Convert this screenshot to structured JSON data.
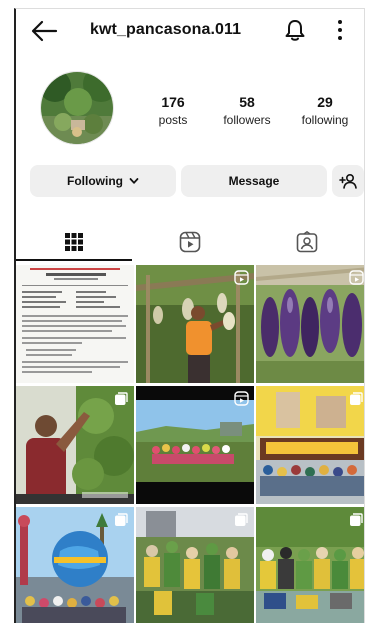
{
  "header": {
    "username": "kwt_pancasona.011",
    "back_icon": "arrow-left-icon",
    "notification_icon": "bell-icon",
    "more_icon": "more-vertical-icon"
  },
  "profile": {
    "stats": [
      {
        "value": "176",
        "label": "posts"
      },
      {
        "value": "58",
        "label": "followers"
      },
      {
        "value": "29",
        "label": "following"
      }
    ]
  },
  "actions": {
    "following_label": "Following",
    "message_label": "Message",
    "add_user_icon": "person-add-icon"
  },
  "tabs": [
    {
      "icon": "grid-icon",
      "active": true
    },
    {
      "icon": "reels-icon",
      "active": false
    },
    {
      "icon": "tagged-icon",
      "active": false
    }
  ],
  "posts": [
    {
      "caption": "",
      "type": "photo"
    },
    {
      "caption": "",
      "type": "reel"
    },
    {
      "caption": "",
      "type": "reel"
    },
    {
      "caption": "",
      "type": "carousel"
    },
    {
      "caption": "",
      "type": "carousel"
    },
    {
      "caption": "",
      "type": "carousel"
    },
    {
      "caption": "",
      "type": "carousel"
    },
    {
      "caption": "",
      "type": "carousel"
    },
    {
      "caption": "",
      "type": "carousel"
    }
  ],
  "colors": {
    "button_bg": "#efefef",
    "text": "#111111"
  }
}
